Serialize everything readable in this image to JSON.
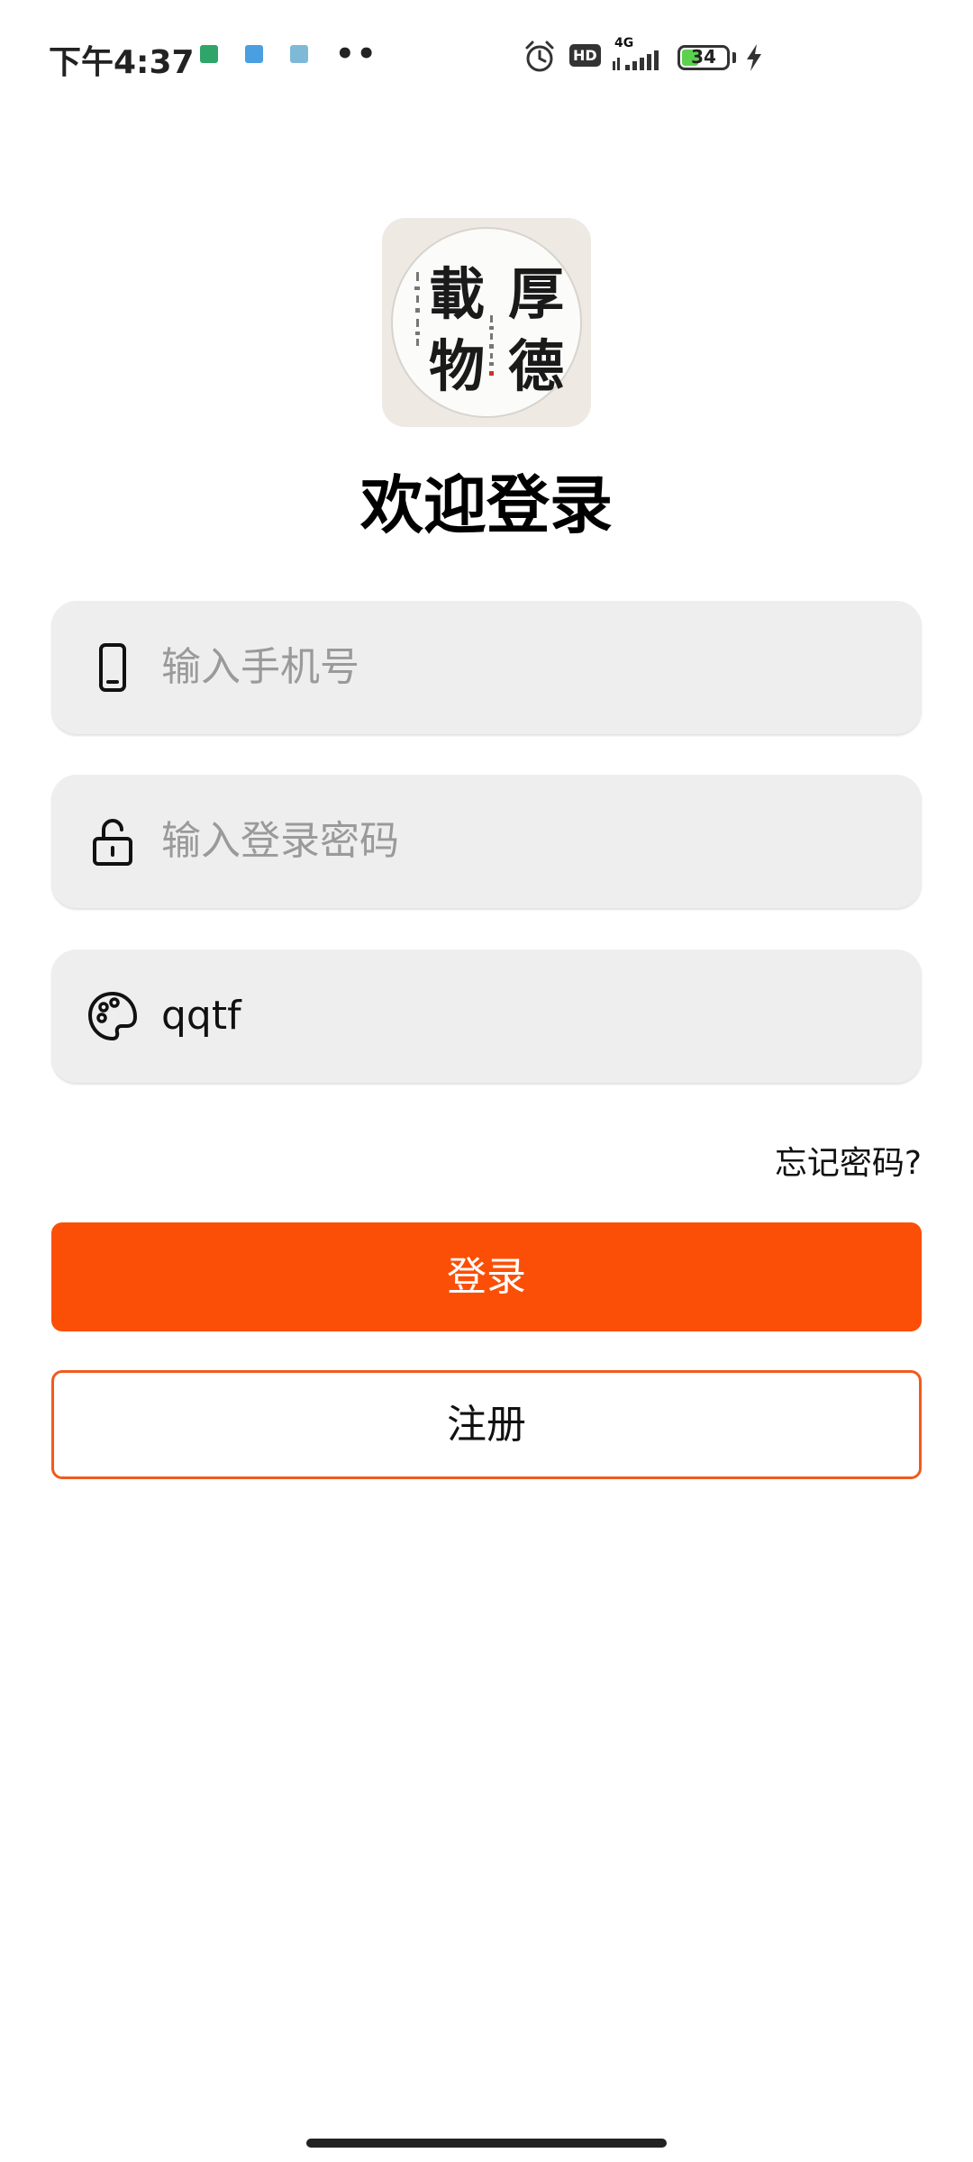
{
  "status_bar": {
    "time": "下午4:37",
    "network": "4G",
    "hd": "HD",
    "battery_level": 34,
    "battery_text": "34",
    "more": "••"
  },
  "app": {
    "logo_characters": [
      "厚",
      "德",
      "載",
      "物"
    ],
    "title": "欢迎登录"
  },
  "form": {
    "phone": {
      "placeholder": "输入手机号",
      "icon": "phone-icon"
    },
    "password": {
      "placeholder": "输入登录密码",
      "icon": "unlock-icon"
    },
    "code": {
      "value": "qqtf",
      "icon": "palette-icon"
    }
  },
  "links": {
    "forgot_password": "忘记密码?"
  },
  "buttons": {
    "login": "登录",
    "register": "注册"
  },
  "colors": {
    "primary": "#fb4f07",
    "register_border": "#f05a1f",
    "field_background": "#eeeeee"
  }
}
